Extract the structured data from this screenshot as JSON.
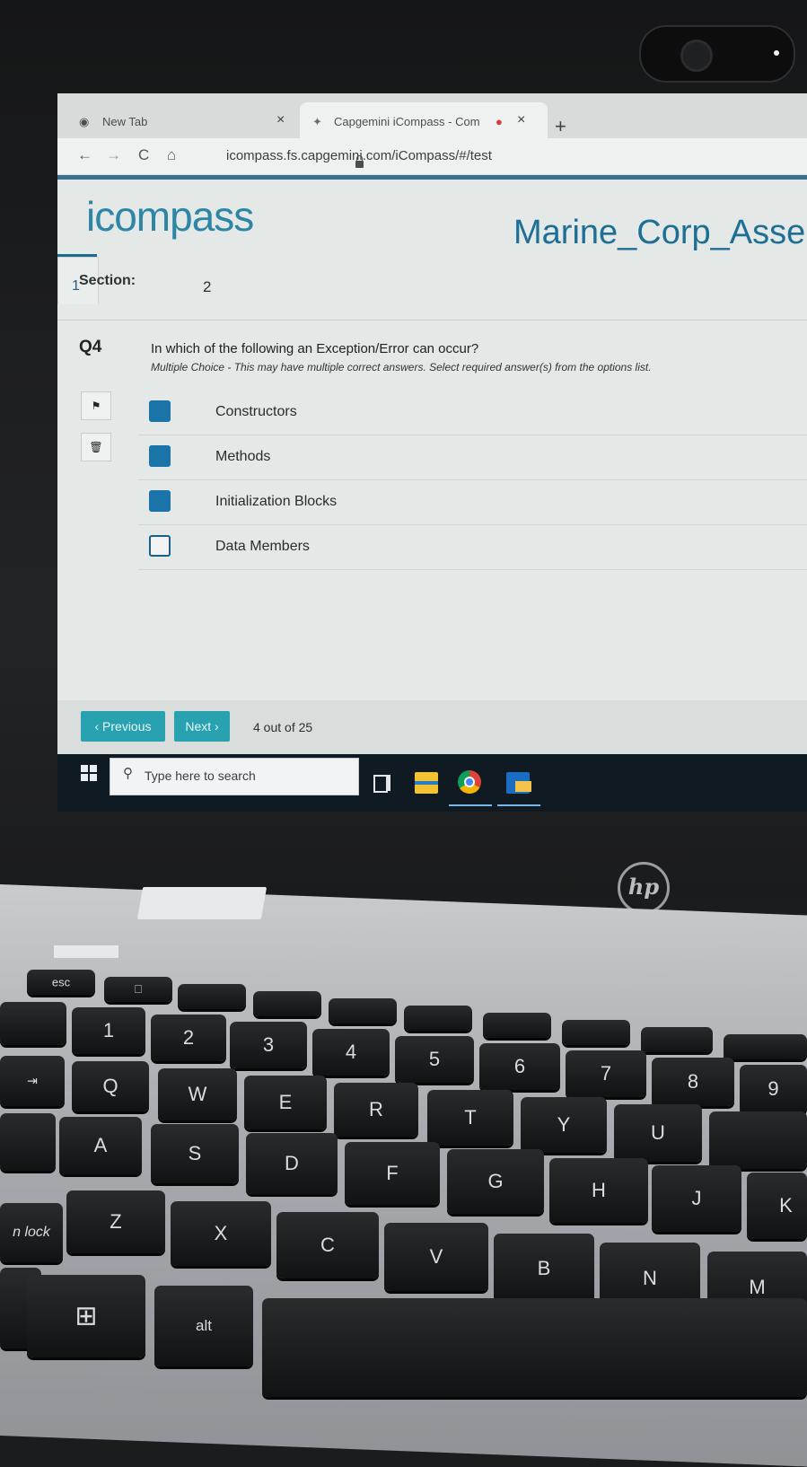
{
  "browser": {
    "tabs": [
      {
        "label": "New Tab"
      },
      {
        "label": "Capgemini iCompass - Com"
      }
    ],
    "close_glyph": "×",
    "new_tab_glyph": "+",
    "nav": {
      "back": "←",
      "forward": "→",
      "reload": "C",
      "home": "⌂"
    },
    "address": "icompass.fs.capgemini.com/iCompass/#/test"
  },
  "app": {
    "logo": "icompass",
    "title": "Marine_Corp_Asse"
  },
  "section": {
    "label": "Section:",
    "tabs": [
      "1",
      "2"
    ],
    "active": "1"
  },
  "question": {
    "number": "Q4",
    "text": "In which of the following an Exception/Error can occur?",
    "hint": "Multiple Choice - This may have multiple correct answers. Select required answer(s) from the options list.",
    "options": [
      {
        "label": "Constructors",
        "checked": true
      },
      {
        "label": "Methods",
        "checked": true
      },
      {
        "label": "Initialization Blocks",
        "checked": true
      },
      {
        "label": "Data Members",
        "checked": false
      }
    ]
  },
  "footer": {
    "previous": "‹ Previous",
    "next": "Next ›",
    "progress": "4 out of 25"
  },
  "taskbar": {
    "search_placeholder": "Type here to search",
    "icons": [
      "windows-start-icon",
      "task-view-icon",
      "file-explorer-icon",
      "chrome-icon",
      "outlook-icon"
    ]
  },
  "device": {
    "brand_logo": "hp",
    "keys": {
      "esc": "esc",
      "n1": "1",
      "n2": "2",
      "n3": "3",
      "n4": "4",
      "n5": "5",
      "n6": "6",
      "n7": "7",
      "n8": "8",
      "n9": "9",
      "Q": "Q",
      "W": "W",
      "E": "E",
      "R": "R",
      "T": "T",
      "Y": "Y",
      "U": "U",
      "A": "A",
      "S": "S",
      "D": "D",
      "F": "F",
      "G": "G",
      "H": "H",
      "J": "J",
      "K": "K",
      "Z": "Z",
      "X": "X",
      "C": "C",
      "V": "V",
      "B": "B",
      "N": "N",
      "M": "M",
      "alt": "alt",
      "lock": "n lock"
    }
  },
  "colors": {
    "accent": "#1a74a8",
    "brand_teal": "#2e86a6",
    "button_teal": "#28a1b0",
    "title_blue": "#1d6f96"
  }
}
